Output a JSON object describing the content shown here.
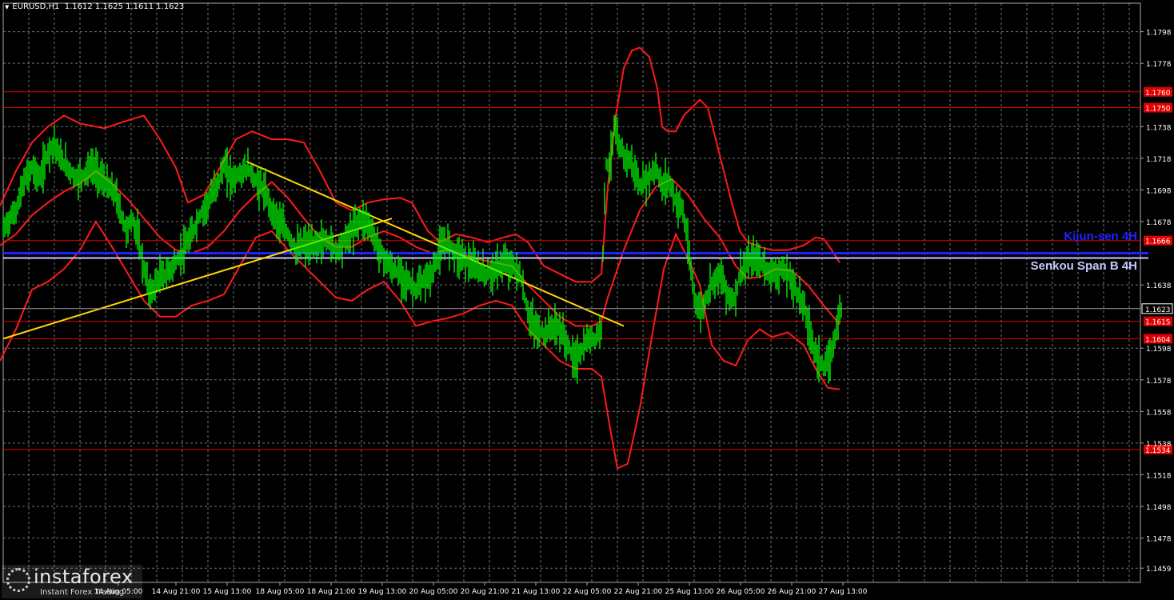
{
  "header": {
    "symbol": "EURUSD,H1",
    "ohlc": "1.1612 1.1625 1.1611 1.1623"
  },
  "logo": {
    "brand": "instaforex",
    "tagline": "Instant Forex Trading"
  },
  "colors": {
    "background": "#000000",
    "grid": "#9a9a9a",
    "candles": "#00ff00",
    "bollinger": "#ff1a1a",
    "levels": "#e00000",
    "trendlines": "#ffd700",
    "kijun": "#2222ff",
    "senkou": "#c8c8ff"
  },
  "chart_data": {
    "type": "line",
    "title": "EURUSD,H1",
    "y_axis_ticks": [
      "1.1798",
      "1.1778",
      "1.1738",
      "1.1718",
      "1.1698",
      "1.1678",
      "1.1638",
      "1.1598",
      "1.1578",
      "1.1558",
      "1.1538",
      "1.1518",
      "1.1498",
      "1.1478",
      "1.1459"
    ],
    "x_axis_ticks": [
      "14 Aug 05:00",
      "14 Aug 21:00",
      "15 Aug 13:00",
      "18 Aug 05:00",
      "18 Aug 21:00",
      "19 Aug 13:00",
      "20 Aug 05:00",
      "20 Aug 21:00",
      "21 Aug 13:00",
      "22 Aug 05:00",
      "22 Aug 21:00",
      "25 Aug 13:00",
      "26 Aug 05:00",
      "26 Aug 21:00",
      "27 Aug 13:00"
    ],
    "ylim": [
      1.145,
      1.1816
    ],
    "last_price": 1.1623,
    "horizontal_levels": [
      {
        "value": 1.176,
        "label": "1.1760"
      },
      {
        "value": 1.175,
        "label": "1.1750"
      },
      {
        "value": 1.1666,
        "label": "1.1666"
      },
      {
        "value": 1.1615,
        "label": "1.1615"
      },
      {
        "value": 1.1604,
        "label": "1.1604"
      },
      {
        "value": 1.1534,
        "label": "1.1534"
      }
    ],
    "indicator_lines": [
      {
        "name": "Kijun-sen 4H",
        "value": 1.1658
      },
      {
        "name": "Senkou Span B 4H",
        "value": 1.1656
      }
    ],
    "price_path": [
      [
        0,
        1.167
      ],
      [
        10,
        1.1678
      ],
      [
        20,
        1.1685
      ],
      [
        30,
        1.1703
      ],
      [
        40,
        1.1712
      ],
      [
        50,
        1.1705
      ],
      [
        60,
        1.1722
      ],
      [
        68,
        1.1728
      ],
      [
        75,
        1.1718
      ],
      [
        85,
        1.1712
      ],
      [
        95,
        1.1705
      ],
      [
        105,
        1.1708
      ],
      [
        115,
        1.1713
      ],
      [
        125,
        1.1707
      ],
      [
        135,
        1.17
      ],
      [
        145,
        1.1695
      ],
      [
        150,
        1.1685
      ],
      [
        158,
        1.1672
      ],
      [
        165,
        1.168
      ],
      [
        172,
        1.167
      ],
      [
        180,
        1.1648
      ],
      [
        188,
        1.1632
      ],
      [
        198,
        1.1642
      ],
      [
        208,
        1.1645
      ],
      [
        220,
        1.1652
      ],
      [
        230,
        1.166
      ],
      [
        240,
        1.167
      ],
      [
        250,
        1.1682
      ],
      [
        260,
        1.169
      ],
      [
        270,
        1.17
      ],
      [
        280,
        1.1713
      ],
      [
        290,
        1.1705
      ],
      [
        300,
        1.1708
      ],
      [
        310,
        1.1712
      ],
      [
        320,
        1.1703
      ],
      [
        330,
        1.1698
      ],
      [
        340,
        1.1685
      ],
      [
        350,
        1.1677
      ],
      [
        360,
        1.167
      ],
      [
        370,
        1.166
      ],
      [
        380,
        1.1664
      ],
      [
        390,
        1.1662
      ],
      [
        400,
        1.1665
      ],
      [
        410,
        1.1666
      ],
      [
        420,
        1.166
      ],
      [
        430,
        1.1665
      ],
      [
        440,
        1.1672
      ],
      [
        450,
        1.168
      ],
      [
        460,
        1.1678
      ],
      [
        470,
        1.1665
      ],
      [
        480,
        1.1655
      ],
      [
        490,
        1.1648
      ],
      [
        500,
        1.1645
      ],
      [
        510,
        1.164
      ],
      [
        520,
        1.1635
      ],
      [
        530,
        1.164
      ],
      [
        540,
        1.1645
      ],
      [
        550,
        1.166
      ],
      [
        560,
        1.1665
      ],
      [
        570,
        1.1658
      ],
      [
        580,
        1.1655
      ],
      [
        590,
        1.165
      ],
      [
        600,
        1.1647
      ],
      [
        610,
        1.1645
      ],
      [
        620,
        1.1648
      ],
      [
        630,
        1.1652
      ],
      [
        640,
        1.165
      ],
      [
        650,
        1.1645
      ],
      [
        660,
        1.162
      ],
      [
        670,
        1.161
      ],
      [
        680,
        1.1607
      ],
      [
        690,
        1.1612
      ],
      [
        700,
        1.161
      ],
      [
        710,
        1.16
      ],
      [
        718,
        1.159
      ],
      [
        726,
        1.1595
      ],
      [
        735,
        1.1603
      ],
      [
        745,
        1.1605
      ],
      [
        752,
        1.161
      ],
      [
        755,
        1.1685
      ],
      [
        758,
        1.1715
      ],
      [
        762,
        1.1712
      ],
      [
        768,
        1.1738
      ],
      [
        772,
        1.1728
      ],
      [
        780,
        1.172
      ],
      [
        790,
        1.1715
      ],
      [
        800,
        1.17
      ],
      [
        810,
        1.1705
      ],
      [
        820,
        1.1712
      ],
      [
        828,
        1.17
      ],
      [
        836,
        1.1705
      ],
      [
        845,
        1.169
      ],
      [
        852,
        1.1688
      ],
      [
        858,
        1.1672
      ],
      [
        863,
        1.165
      ],
      [
        868,
        1.1632
      ],
      [
        875,
        1.162
      ],
      [
        882,
        1.1628
      ],
      [
        890,
        1.164
      ],
      [
        900,
        1.1645
      ],
      [
        910,
        1.1632
      ],
      [
        918,
        1.1628
      ],
      [
        925,
        1.1645
      ],
      [
        935,
        1.1652
      ],
      [
        945,
        1.1655
      ],
      [
        955,
        1.165
      ],
      [
        965,
        1.1645
      ],
      [
        975,
        1.1647
      ],
      [
        985,
        1.1645
      ],
      [
        995,
        1.1635
      ],
      [
        1005,
        1.1625
      ],
      [
        1012,
        1.161
      ],
      [
        1018,
        1.1598
      ],
      [
        1025,
        1.159
      ],
      [
        1032,
        1.1585
      ],
      [
        1040,
        1.1595
      ],
      [
        1046,
        1.1612
      ],
      [
        1052,
        1.1623
      ]
    ],
    "bollinger_upper": [
      [
        0,
        1.1688
      ],
      [
        20,
        1.171
      ],
      [
        40,
        1.1728
      ],
      [
        60,
        1.1738
      ],
      [
        80,
        1.1745
      ],
      [
        100,
        1.174
      ],
      [
        130,
        1.1737
      ],
      [
        160,
        1.1742
      ],
      [
        180,
        1.1745
      ],
      [
        200,
        1.173
      ],
      [
        220,
        1.1712
      ],
      [
        235,
        1.169
      ],
      [
        255,
        1.1695
      ],
      [
        275,
        1.1712
      ],
      [
        295,
        1.173
      ],
      [
        315,
        1.1735
      ],
      [
        340,
        1.173
      ],
      [
        360,
        1.173
      ],
      [
        380,
        1.1728
      ],
      [
        400,
        1.171
      ],
      [
        420,
        1.169
      ],
      [
        440,
        1.1685
      ],
      [
        460,
        1.169
      ],
      [
        480,
        1.1692
      ],
      [
        500,
        1.1693
      ],
      [
        515,
        1.169
      ],
      [
        535,
        1.1672
      ],
      [
        550,
        1.1665
      ],
      [
        570,
        1.167
      ],
      [
        590,
        1.1668
      ],
      [
        610,
        1.1665
      ],
      [
        630,
        1.1668
      ],
      [
        645,
        1.167
      ],
      [
        660,
        1.1665
      ],
      [
        680,
        1.165
      ],
      [
        700,
        1.1645
      ],
      [
        720,
        1.164
      ],
      [
        740,
        1.164
      ],
      [
        752,
        1.1645
      ],
      [
        760,
        1.17
      ],
      [
        770,
        1.1745
      ],
      [
        780,
        1.1775
      ],
      [
        790,
        1.1786
      ],
      [
        800,
        1.1788
      ],
      [
        812,
        1.1782
      ],
      [
        822,
        1.1762
      ],
      [
        828,
        1.1738
      ],
      [
        835,
        1.1735
      ],
      [
        845,
        1.1735
      ],
      [
        855,
        1.1745
      ],
      [
        865,
        1.175
      ],
      [
        875,
        1.1755
      ],
      [
        885,
        1.175
      ],
      [
        895,
        1.173
      ],
      [
        905,
        1.171
      ],
      [
        915,
        1.169
      ],
      [
        925,
        1.1672
      ],
      [
        935,
        1.1665
      ],
      [
        950,
        1.1662
      ],
      [
        965,
        1.166
      ],
      [
        985,
        1.166
      ],
      [
        1005,
        1.1663
      ],
      [
        1020,
        1.1668
      ],
      [
        1030,
        1.1667
      ],
      [
        1040,
        1.166
      ],
      [
        1050,
        1.1652
      ]
    ],
    "bollinger_middle": [
      [
        0,
        1.1663
      ],
      [
        20,
        1.167
      ],
      [
        40,
        1.1682
      ],
      [
        60,
        1.169
      ],
      [
        80,
        1.1697
      ],
      [
        100,
        1.1702
      ],
      [
        120,
        1.171
      ],
      [
        140,
        1.1702
      ],
      [
        160,
        1.1692
      ],
      [
        180,
        1.168
      ],
      [
        200,
        1.1668
      ],
      [
        220,
        1.166
      ],
      [
        240,
        1.1658
      ],
      [
        260,
        1.1662
      ],
      [
        280,
        1.1672
      ],
      [
        300,
        1.1685
      ],
      [
        320,
        1.1695
      ],
      [
        340,
        1.1703
      ],
      [
        360,
        1.1693
      ],
      [
        380,
        1.168
      ],
      [
        400,
        1.1668
      ],
      [
        420,
        1.1662
      ],
      [
        440,
        1.1662
      ],
      [
        460,
        1.1668
      ],
      [
        480,
        1.1672
      ],
      [
        500,
        1.1668
      ],
      [
        520,
        1.1662
      ],
      [
        540,
        1.1658
      ],
      [
        560,
        1.166
      ],
      [
        580,
        1.1657
      ],
      [
        600,
        1.1654
      ],
      [
        620,
        1.1652
      ],
      [
        640,
        1.165
      ],
      [
        660,
        1.1638
      ],
      [
        680,
        1.1628
      ],
      [
        700,
        1.1618
      ],
      [
        720,
        1.1612
      ],
      [
        740,
        1.1612
      ],
      [
        752,
        1.1615
      ],
      [
        760,
        1.163
      ],
      [
        780,
        1.166
      ],
      [
        800,
        1.1685
      ],
      [
        820,
        1.17
      ],
      [
        840,
        1.1705
      ],
      [
        860,
        1.1695
      ],
      [
        880,
        1.168
      ],
      [
        900,
        1.1668
      ],
      [
        920,
        1.165
      ],
      [
        935,
        1.1642
      ],
      [
        950,
        1.1643
      ],
      [
        970,
        1.1648
      ],
      [
        990,
        1.1647
      ],
      [
        1010,
        1.1638
      ],
      [
        1030,
        1.1625
      ],
      [
        1050,
        1.1613
      ]
    ],
    "bollinger_lower": [
      [
        0,
        1.159
      ],
      [
        20,
        1.161
      ],
      [
        40,
        1.1635
      ],
      [
        60,
        1.164
      ],
      [
        80,
        1.1648
      ],
      [
        100,
        1.166
      ],
      [
        120,
        1.1678
      ],
      [
        140,
        1.1662
      ],
      [
        160,
        1.1645
      ],
      [
        180,
        1.1628
      ],
      [
        200,
        1.1618
      ],
      [
        220,
        1.1618
      ],
      [
        240,
        1.1625
      ],
      [
        260,
        1.1628
      ],
      [
        280,
        1.1632
      ],
      [
        300,
        1.165
      ],
      [
        320,
        1.1668
      ],
      [
        340,
        1.1672
      ],
      [
        360,
        1.166
      ],
      [
        380,
        1.165
      ],
      [
        400,
        1.164
      ],
      [
        420,
        1.163
      ],
      [
        440,
        1.1628
      ],
      [
        460,
        1.1635
      ],
      [
        480,
        1.164
      ],
      [
        500,
        1.1628
      ],
      [
        520,
        1.1612
      ],
      [
        540,
        1.1615
      ],
      [
        560,
        1.1617
      ],
      [
        580,
        1.162
      ],
      [
        600,
        1.1625
      ],
      [
        620,
        1.1628
      ],
      [
        640,
        1.1625
      ],
      [
        660,
        1.161
      ],
      [
        680,
        1.16
      ],
      [
        700,
        1.159
      ],
      [
        720,
        1.1585
      ],
      [
        740,
        1.1585
      ],
      [
        752,
        1.158
      ],
      [
        762,
        1.155
      ],
      [
        772,
        1.1522
      ],
      [
        785,
        1.1525
      ],
      [
        800,
        1.156
      ],
      [
        815,
        1.1605
      ],
      [
        830,
        1.1648
      ],
      [
        845,
        1.167
      ],
      [
        860,
        1.1655
      ],
      [
        875,
        1.1638
      ],
      [
        890,
        1.16
      ],
      [
        905,
        1.159
      ],
      [
        920,
        1.1587
      ],
      [
        935,
        1.1603
      ],
      [
        950,
        1.161
      ],
      [
        965,
        1.1605
      ],
      [
        985,
        1.1608
      ],
      [
        1005,
        1.16
      ],
      [
        1020,
        1.1585
      ],
      [
        1035,
        1.1573
      ],
      [
        1050,
        1.1572
      ]
    ],
    "trendlines": [
      [
        [
          4,
          1.1604
        ],
        [
          490,
          1.168
        ]
      ],
      [
        [
          308,
          1.1716
        ],
        [
          780,
          1.1612
        ]
      ]
    ]
  }
}
